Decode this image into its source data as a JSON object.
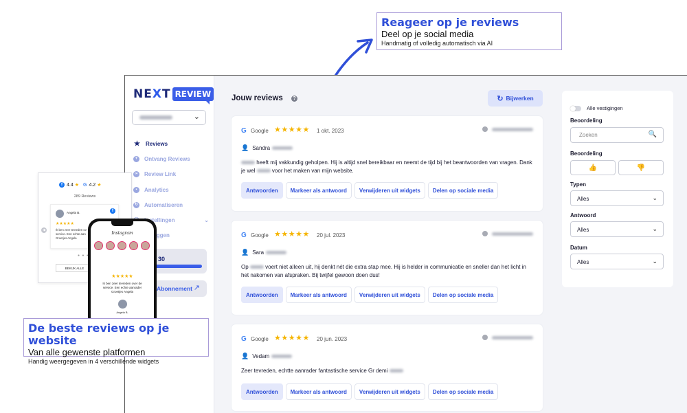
{
  "callout_top": {
    "heading": "Reageer op je reviews",
    "sub": "Deel op je social media",
    "small": "Handmatig of volledig automatisch via AI"
  },
  "callout_bottom": {
    "heading": "De beste reviews op je website",
    "sub": "Van alle gewenste platformen",
    "small": "Handig weergegeven in 4 verschillende widgets"
  },
  "sidebar": {
    "logo_next": "NE",
    "logo_x": "X",
    "logo_t": "T",
    "logo_review": "REVIEW",
    "items": [
      {
        "label": "Reviews"
      },
      {
        "label": "Ontvang Reviews"
      },
      {
        "label": "Review Link"
      },
      {
        "label": "Analytics"
      },
      {
        "label": "Automatiseren"
      },
      {
        "label": "Instellingen"
      },
      {
        "label": "Uitloggen"
      }
    ],
    "progress_value": "30",
    "progress_fill": 1.0,
    "abonnement": "Abonnement"
  },
  "main": {
    "title": "Jouw reviews",
    "refresh": "Bijwerken",
    "reviews": [
      {
        "platform": "Google",
        "stars": "★★★★★",
        "date": "1 okt. 2023",
        "author": "Sandra",
        "text_parts": [
          "heeft mij vakkundig geholpen. Hij is altijd snel bereikbaar en neemt de tijd bij het beantwoorden van vragen. Dank je wel",
          "voor het maken van mijn website."
        ]
      },
      {
        "platform": "Google",
        "stars": "★★★★★",
        "date": "20 jul. 2023",
        "author": "Sara",
        "text_parts": [
          "Op",
          "voert niet alleen uit, hij denkt nét die extra stap mee. Hij is helder in communicatie en sneller dan het licht in het nakomen van afspraken. Bij twijfel gewoon doen dus!"
        ]
      },
      {
        "platform": "Google",
        "stars": "★★★★★",
        "date": "20 jun. 2023",
        "author": "Vedam",
        "text_parts": [
          "Zeer tevreden, echtte aanrader fantastische service Gr demi",
          ""
        ]
      }
    ],
    "actions": {
      "reply": "Antwoorden",
      "mark": "Markeer als antwoord",
      "remove": "Verwijderen uit widgets",
      "share": "Delen op sociale media"
    }
  },
  "filter": {
    "all_locations": "Alle vestigingen",
    "rating_label_1": "Beoordeling",
    "search_placeholder": "Zoeken",
    "rating_label_2": "Beoordeling",
    "types_label": "Typen",
    "types_value": "Alles",
    "answer_label": "Antwoord",
    "answer_value": "Alles",
    "date_label": "Datum",
    "date_value": "Alles"
  },
  "widget": {
    "fb_rating": "4.4",
    "google_rating": "4.2",
    "count": "289 Reviews",
    "reviewer": "Angela B.",
    "stars": "★★★★★",
    "text": "Ik ben zeer tevreden ov service. Een echte aan Groetjes Angela",
    "more": "BEKIJK ALLE"
  },
  "phone": {
    "app": "Instagram",
    "stars": "★★★★★",
    "text": "Ik ben zeer tevreden over de service. Een echte aanrader Groetjes Angela",
    "name": "Angela B."
  }
}
